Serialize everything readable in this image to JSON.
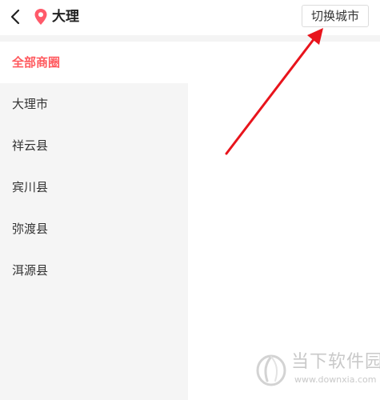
{
  "header": {
    "city": "大理",
    "switch_label": "切换城市",
    "back_icon": "chevron-left-icon",
    "location_icon": "map-pin-icon"
  },
  "sidebar": {
    "items": [
      {
        "label": "全部商圈",
        "active": true
      },
      {
        "label": "大理市",
        "active": false
      },
      {
        "label": "祥云县",
        "active": false
      },
      {
        "label": "宾川县",
        "active": false
      },
      {
        "label": "弥渡县",
        "active": false
      },
      {
        "label": "洱源县",
        "active": false
      }
    ]
  },
  "watermark": {
    "title": "当下软件园",
    "url": "www.downxia.com"
  },
  "colors": {
    "accent": "#ff5a5f",
    "arrow": "#e8141c",
    "sidebar_bg": "#f5f5f5"
  }
}
